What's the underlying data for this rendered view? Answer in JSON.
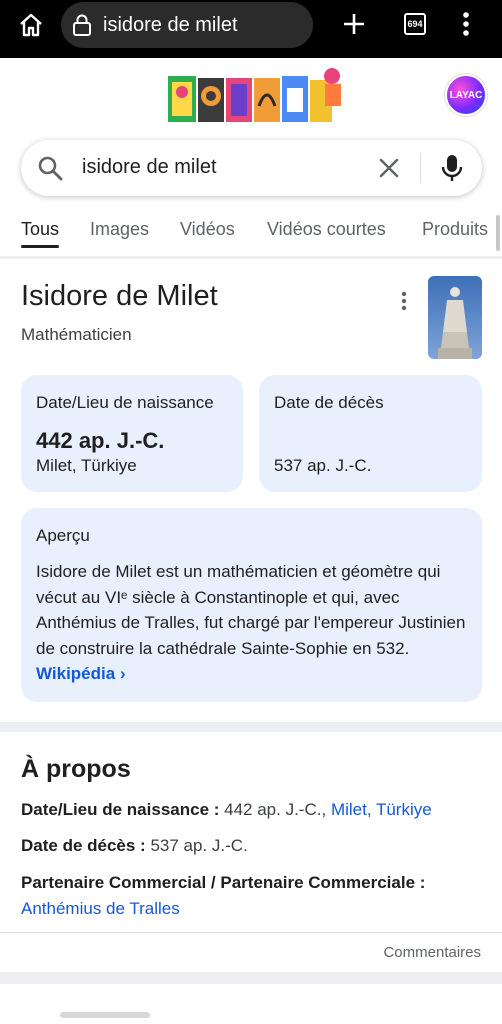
{
  "browser": {
    "url": "isidore de milet",
    "tab_count": "694",
    "icons": [
      "home-icon",
      "lock-icon",
      "plus-icon",
      "tabs-icon",
      "kebab-menu-icon"
    ]
  },
  "header": {
    "avatar_label": "LAYAC"
  },
  "search": {
    "query": "isidore de milet"
  },
  "filters": {
    "tabs": [
      "Tous",
      "Images",
      "Vidéos",
      "Vidéos courtes",
      "Produits"
    ],
    "active": "Tous"
  },
  "knowledge_panel": {
    "title": "Isidore de Milet",
    "subtitle": "Mathématicien",
    "birth_card": {
      "label": "Date/Lieu de naissance",
      "value": "442 ap. J.-C.",
      "place": "Milet, Türkiye"
    },
    "death_card": {
      "label": "Date de décès",
      "value": "537 ap. J.-C."
    },
    "overview": {
      "label": "Aperçu",
      "text": "Isidore de Milet est un mathématicien et géomètre qui vécut au VIᵉ siècle à Constantinople et qui, avec Anthémius de Tralles, fut chargé par l'empereur Justinien de construire la cathédrale Sainte-Sophie en 532.",
      "link": "Wikipédia",
      "link_arrow": "›"
    }
  },
  "about": {
    "title": "À propos",
    "birth_key": "Date/Lieu de naissance :",
    "birth_value": "442 ap. J.-C.,",
    "birth_place_link": "Milet, Türkiye",
    "death_key": "Date de décès :",
    "death_value": "537 ap. J.-C.",
    "partner_key": "Partenaire Commercial / Partenaire Commerciale :",
    "partner_link": "Anthémius de Tralles",
    "feedback": "Commentaires"
  },
  "colors": {
    "card_bg": "#e8f0fe",
    "link": "#1558d6",
    "topbar": "#000000"
  }
}
